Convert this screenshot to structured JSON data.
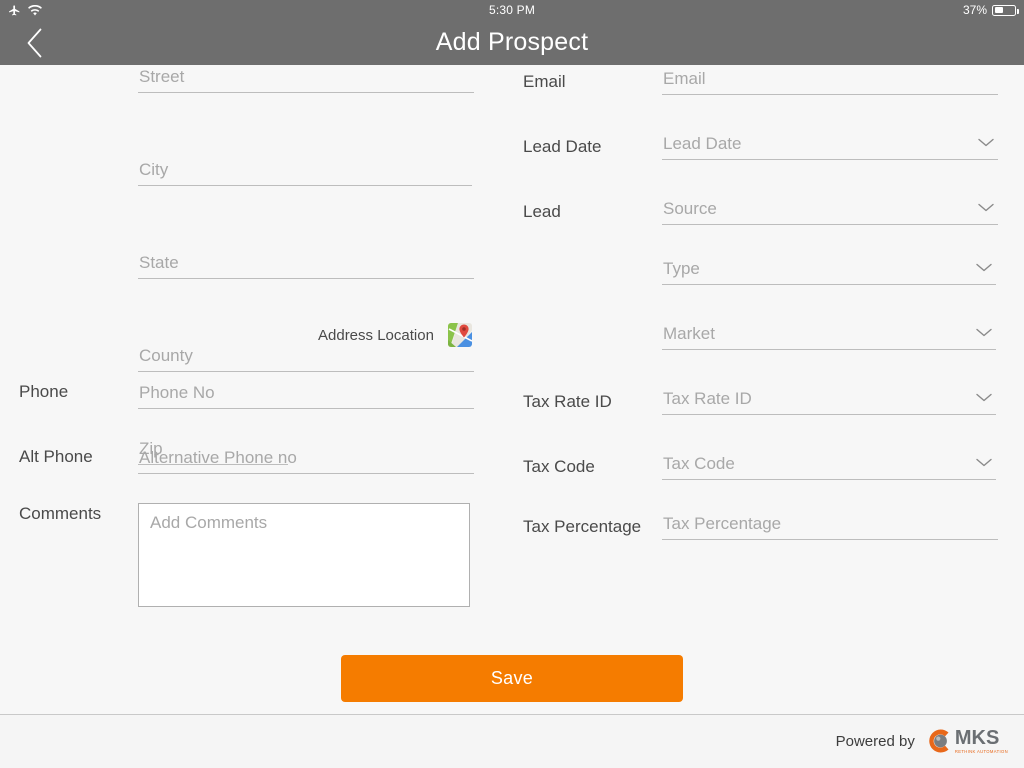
{
  "status_bar": {
    "airplane_icon": "airplane-icon",
    "wifi_icon": "wifi-icon",
    "time": "5:30 PM",
    "battery_percent": "37%",
    "battery_icon": "battery-icon"
  },
  "nav": {
    "back_icon": "chevron-left-icon",
    "title": "Add Prospect"
  },
  "form": {
    "left": {
      "street": {
        "label": "",
        "placeholder": "Street"
      },
      "city": {
        "label": "",
        "placeholder": "City"
      },
      "state": {
        "label": "",
        "placeholder": "State"
      },
      "county": {
        "label": "",
        "placeholder": "County"
      },
      "zip": {
        "label": "",
        "placeholder": "Zip"
      },
      "address_location": {
        "label": "Address Location",
        "icon": "google-maps-icon"
      },
      "phone": {
        "label": "Phone",
        "placeholder": "Phone No"
      },
      "alt_phone": {
        "label": "Alt Phone",
        "placeholder": "Alternative Phone no"
      },
      "comments": {
        "label": "Comments",
        "placeholder": "Add Comments"
      }
    },
    "right": {
      "email": {
        "label": "Email",
        "placeholder": "Email"
      },
      "lead_date": {
        "label": "Lead Date",
        "placeholder": "Lead Date"
      },
      "lead": {
        "label": "Lead",
        "placeholder": "Source"
      },
      "lead_type": {
        "label": "",
        "placeholder": "Type"
      },
      "lead_market": {
        "label": "",
        "placeholder": "Market"
      },
      "tax_rate_id": {
        "label": "Tax Rate ID",
        "placeholder": "Tax Rate ID"
      },
      "tax_code": {
        "label": "Tax Code",
        "placeholder": "Tax Code"
      },
      "tax_percentage": {
        "label": "Tax Percentage",
        "placeholder": "Tax Percentage"
      }
    }
  },
  "actions": {
    "save_label": "Save"
  },
  "footer": {
    "powered_by": "Powered by",
    "logo_name": "MKS",
    "logo_tagline": "RETHINK AUTOMATION"
  },
  "colors": {
    "nav_bar": "#6e6e6e",
    "page_background": "#f7f7f7",
    "save_button": "#f57c00",
    "brand_orange": "#e8681a",
    "label_text": "#4a4a4a",
    "placeholder_text": "#a8a8a8",
    "underline": "#bdbdbd"
  }
}
